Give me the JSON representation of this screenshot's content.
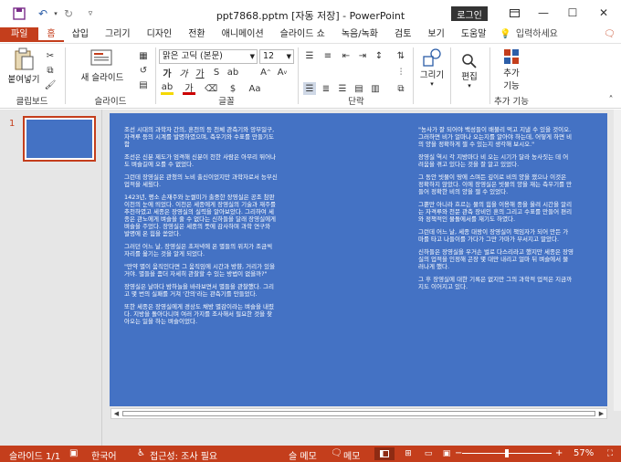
{
  "titlebar": {
    "title": "ppt7868.pptm [자동 저장]  -  PowerPoint",
    "login": "로그인",
    "icons": [
      "save-icon",
      "undo-icon",
      "redo-icon",
      "repeat-icon",
      "customize-icon"
    ]
  },
  "tabs": [
    "파일",
    "홈",
    "삽입",
    "그리기",
    "디자인",
    "전환",
    "애니메이션",
    "슬라이드 쇼",
    "녹음/녹화",
    "검토",
    "보기",
    "도움말"
  ],
  "tell_me": "입력하세요",
  "ribbon": {
    "clipboard": {
      "paste": "붙여넣기",
      "label": "클립보드"
    },
    "slides": {
      "new_slide": "새 슬라이드",
      "label": "슬라이드"
    },
    "font": {
      "name": "맑은 고딕 (본문)",
      "size": "12",
      "label": "글꼴"
    },
    "paragraph": {
      "label": "단락"
    },
    "drawing": {
      "draw": "그리기"
    },
    "editing": {
      "edit": "편집"
    },
    "addins": {
      "add_line1": "추가",
      "add_line2": "기능",
      "label": "추가 기능"
    }
  },
  "thumb_number": "1",
  "slide": {
    "left_paragraphs": [
      "조선 시대의 과학자 간의, 혼천의 등 천체 관측기와 앙부일구, 자격루 등의 시계를 발명하였으며, 측우기와 수표를 만들기도 함",
      "조선은 신분 제도가 엄격해 신분이 천한 사람은 아무리 뛰어나도 벼슬길에 오를 수 없었다.",
      "그런데 장영실은 관청의 노비 출신이었지만 과학자로서 능부신 업적을 세웠다.",
      "1423년, 평소 손재주와 눈썰미가 출중한 장영실은 공조 참판 이천의 눈에 띄었다. 이천은 세종에게 장영실의 기술과 재주를 추천하였고 세종은 장영실의 실력을 알아보았다. 그리하여 세종은 관노에게 벼슬을 줄 수 없다는 신하들을 달래 장영실에게 벼슬을 주었다. 장영실은 세종의 뜻에 감사하며 과학 연구와 발명에 온 힘을 쏟았다.",
      "그러던 어느 날, 장영실은 초저녁에 온 별들의 위치가 조금씩 자리를 옮기는 것을 알게 되었다.",
      "\"만약 별이 움직인다면 그 움직임에 시간과 방향, 거리가 있을 거야. 별들을 좀더 자세히 관찰할 수 있는 방법이 없을까?\"",
      "장영실은 날마다 밤하늘을 바라보면서 별들을 관찰했다. 그리고 몇 번의 실패를 거쳐 '간의'라는 관측기를 만들었다.",
      "또한 세종은 장영실에게 경상도 채방 별감이라는 벼슬을 내렸다. 지방을 돌아다니며 여러 가지를 조사해서 필요한 것을 찾아오는 일을 하는 벼슬이었다."
    ],
    "right_paragraphs": [
      "\"농사가 잘 되어야 백성들이 배불리 먹고 지낼 수 있을 것이오. 그러하면 비가 얼마나 오는지를 알아야 하는데, 어떻게 하면 비의 양을 정확하게 잴 수 있는지 생각해 보시오.\"",
      "장영실 역시 각 지방마다 비 오는 시기가 달라 농사짓는 데 어려움을 겪고 있다는 것을 잘 알고 있었다.",
      "그 동안 빗물이 땅에 스며든 깊이로 비의 양을 쟀으나 이것은 정확하지 않았다. 이에 장영실은 빗물의 양을 재는 측우기를 만들어 정확한 비의 양을 잴 수 있었다.",
      "그뿐만 아니라 흐르는 물의 힘을 이용해 종을 울려 시간을 알리는 자격루와 천문 관측 장비인 혼의 그리고 수표를 만들어 편리와 정책적인 물돌에서를 재기도 하였다.",
      "그런데 어느 날, 세종 대왕이 장영실이 책임자가 되어 만든 가마를 타고 나들이를 가다가 그만 가마가 부서지고 말았다.",
      "신하들은 장영실을 우거손 벌로 다스리라고 했지만 세종은 장영실의 업적을 인정해 곤장 몇 대만 내리고 얼마 뒤 벼슬에서 물러나게 했다.",
      "그 후 장영실에 대한 기록은 없지만 그의 과학적 업적은 지금까지도 이어지고 있다."
    ]
  },
  "status": {
    "slide_count": "슬라이드 1/1",
    "language": "한국어",
    "accessibility": "접근성: 조사 필요",
    "notes": "슬 메모",
    "comments": "메모",
    "zoom": "57%"
  }
}
